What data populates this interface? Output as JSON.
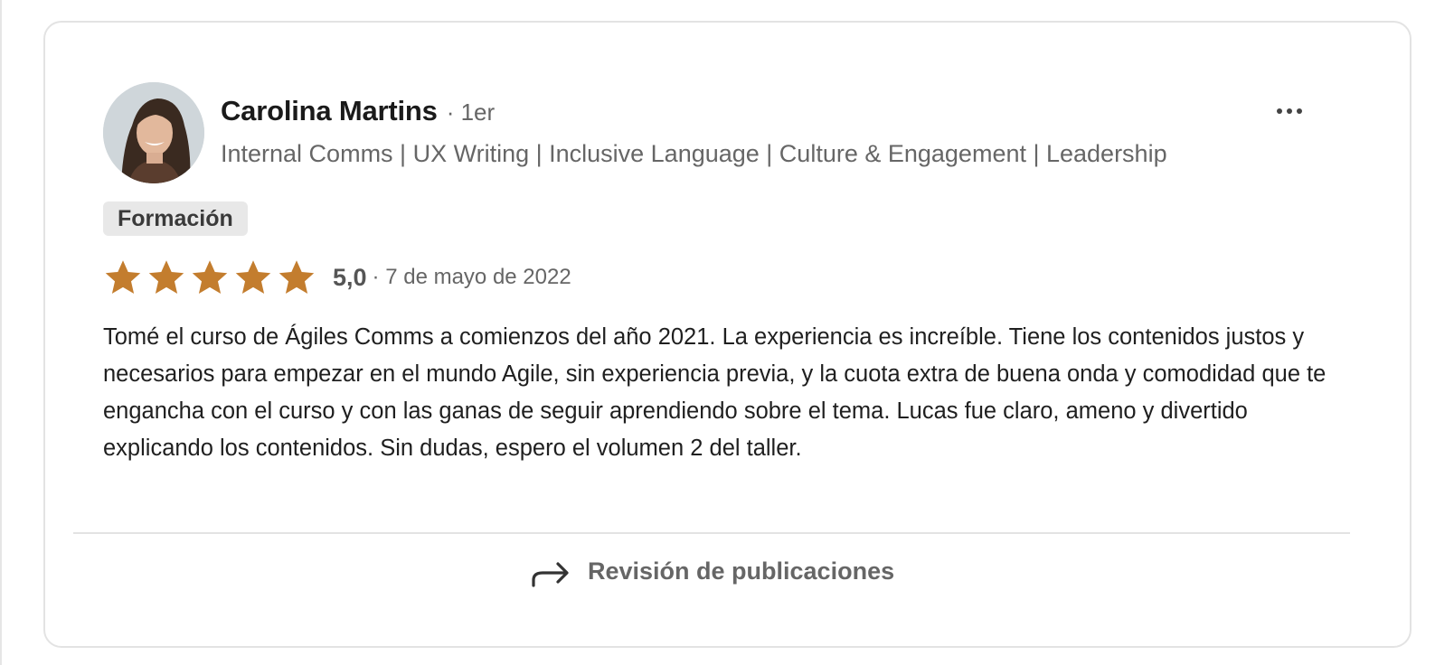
{
  "review": {
    "author": {
      "name": "Carolina Martins",
      "degree": "· 1er",
      "headline": "Internal Comms | UX Writing | Inclusive Language | Culture & Engagement | Leadership",
      "avatar_icon": "profile-photo"
    },
    "tag": "Formación",
    "rating": {
      "stars": 5,
      "score": "5,0",
      "date": "· 7 de mayo de 2022",
      "star_color": "#c37d2e"
    },
    "text": "Tomé el curso de Ágiles Comms a comienzos del año 2021. La experiencia es increíble. Tiene los contenidos justos y necesarios para empezar en el mundo Agile, sin experiencia previa, y la cuota extra de buena onda y comodidad que te engancha con el curso y con las ganas de seguir aprendiendo sobre el tema. Lucas fue claro, ameno y divertido explicando los contenidos. Sin dudas, espero el volumen 2 del taller.",
    "more_icon": "ellipsis-icon",
    "footer": {
      "label": "Revisión de publicaciones",
      "icon": "share-arrow-icon"
    }
  }
}
